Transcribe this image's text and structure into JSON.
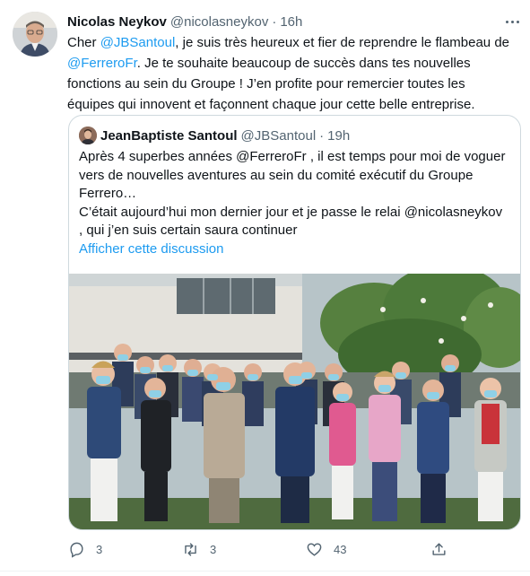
{
  "tweet": {
    "author_name": "Nicolas Neykov",
    "author_handle": "@nicolasneykov",
    "separator": "·",
    "time": "16h",
    "text": {
      "p1": "Cher ",
      "mention1": "@JBSantoul",
      "p2": ", je suis très heureux et fier de reprendre le flambeau de ",
      "mention2": "@FerreroFr",
      "p3": ". Je te souhaite beaucoup de succès dans tes nouvelles fonctions au sein du Groupe ! J’en profite pour remercier toutes les équipes qui innovent et façonnent chaque jour cette belle entreprise."
    }
  },
  "quote": {
    "author_name": "JeanBaptiste Santoul",
    "author_handle": "@JBSantoul",
    "separator": "·",
    "time": "19h",
    "lines": [
      "Après 4 superbes années @FerreroFr , il est temps pour moi de voguer",
      "vers de nouvelles aventures au sein du comité exécutif du Groupe",
      "Ferrero…",
      "C’était aujourd’hui mon dernier jour et je passe le relai @nicolasneykov",
      ", qui j’en suis certain saura continuer"
    ],
    "discussion_link": "Afficher cette discussion"
  },
  "actions": {
    "reply_count": "3",
    "retweet_count": "3",
    "like_count": "43"
  },
  "colors": {
    "link": "#1d9bf0",
    "secondary_text": "#536471",
    "border": "#cfd9de"
  }
}
